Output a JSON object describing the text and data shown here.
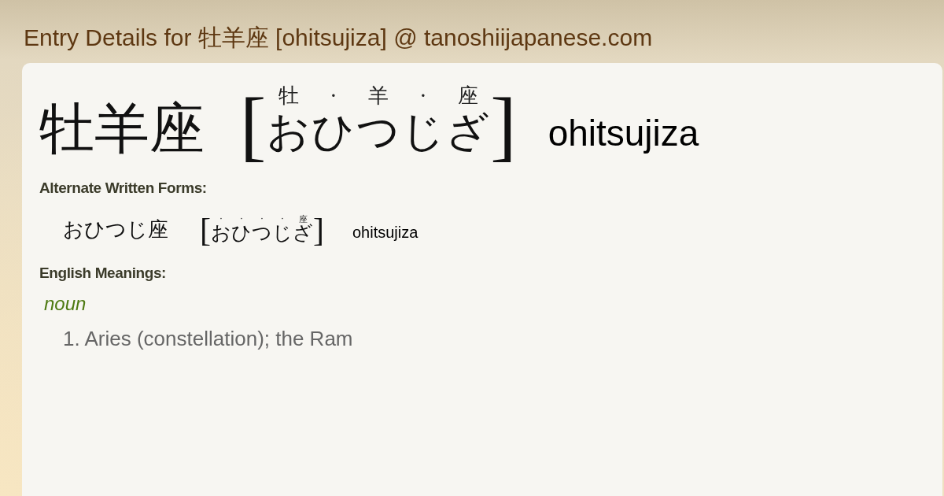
{
  "page_title": "Entry Details for 牡羊座 [ohitsujiza] @ tanoshiijapanese.com",
  "entry": {
    "headword": "牡羊座",
    "reading": {
      "open": "[",
      "segments": [
        {
          "kana": "お",
          "mark": "牡"
        },
        {
          "kana": "ひ",
          "mark": "·"
        },
        {
          "kana": "つ",
          "mark": "羊"
        },
        {
          "kana": "じ",
          "mark": "·"
        },
        {
          "kana": "ざ",
          "mark": "座"
        }
      ],
      "close": "]"
    },
    "romaji": "ohitsujiza"
  },
  "alternate_forms": {
    "heading": "Alternate Written Forms:",
    "forms": [
      {
        "written": "おひつじ座",
        "reading": {
          "open": "[",
          "segments": [
            {
              "kana": "お",
              "mark": "·"
            },
            {
              "kana": "ひ",
              "mark": "·"
            },
            {
              "kana": "つ",
              "mark": "·"
            },
            {
              "kana": "じ",
              "mark": "·"
            },
            {
              "kana": "ざ",
              "mark": "座"
            }
          ],
          "close": "]"
        },
        "romaji": "ohitsujiza"
      }
    ]
  },
  "meanings": {
    "heading": "English Meanings:",
    "groups": [
      {
        "part_of_speech": "noun",
        "senses": [
          "1. Aries (constellation); the Ram"
        ]
      }
    ]
  }
}
